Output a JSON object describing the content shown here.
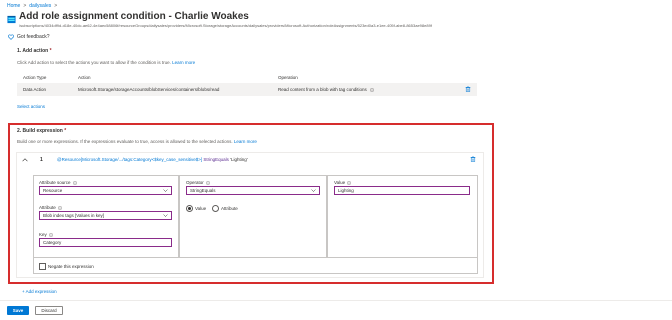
{
  "breadcrumb": {
    "home": "Home",
    "separator": ">",
    "current": "dailysales",
    "trailing": ">"
  },
  "header": {
    "title": "Add role assignment condition - Charlie Woakes",
    "subtitle": "/subscriptions/4034df9d-d18e-40dc-ae62-4e4aec58806f/resourceGroups/dailysales/providers/Microsoft.Storage/storageAccounts/dailysales/providers/Microsoft.Authorization/roleAssignments/523ed0a3-e1ee-405f-abe8-8653ae98e89f",
    "feedback": "Got feedback?"
  },
  "add_action": {
    "title": "1. Add action",
    "required": "*",
    "description": "Click Add action to select the actions you want to allow if the condition is true.",
    "learn_more": "Learn more",
    "columns": [
      "Action Type",
      "Action",
      "Operation"
    ],
    "rows": [
      {
        "type": "Data Action",
        "action": "Microsoft.Storage/storageAccounts/blobServices/containers/blobs/read",
        "operation": "Read content from a blob with tag conditions"
      }
    ],
    "select_actions": "Select actions"
  },
  "build_expression": {
    "title": "2. Build expression",
    "required": "*",
    "description": "Build one or more expressions. If the expressions evaluate to true, access is allowed to the selected actions.",
    "learn_more": "Learn more",
    "expression": {
      "number": "1",
      "text_resource": "@Resource[Microsoft.Storage/.../tags:Category<$key_case_sensitive$>]",
      "text_operator": "StringEquals",
      "text_value": "'Lighting'",
      "attribute_source_label": "Attribute source",
      "attribute_source_value": "Resource",
      "attribute_label": "Attribute",
      "attribute_value": "Blob index tags [Values in key]",
      "key_label": "Key",
      "key_value": "Category",
      "operator_label": "Operator",
      "operator_value": "StringEquals",
      "radio_value": "Value",
      "radio_attribute": "Attribute",
      "value_label": "Value",
      "value_value": "Lighting",
      "negate": "Negate this expression"
    },
    "add_expression": "+ Add expression"
  },
  "footer": {
    "save": "Save",
    "discard": "Discard"
  },
  "colors": {
    "accent": "#0078d4",
    "highlight_border": "#d62d2d",
    "field_border": "#8a2b8a"
  }
}
